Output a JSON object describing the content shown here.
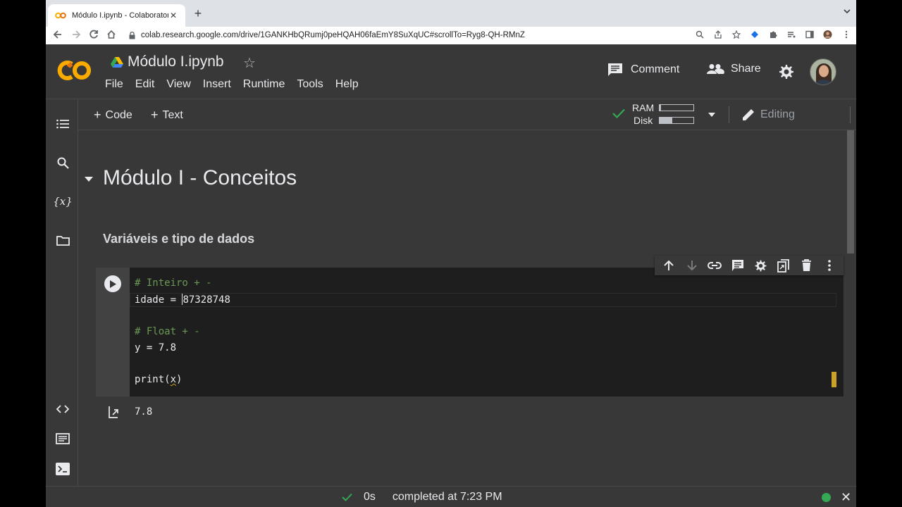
{
  "browser": {
    "tab_title": "Módulo I.ipynb - Colaboratory",
    "tab_close": "✕",
    "new_tab": "+",
    "url": "colab.research.google.com/drive/1GANKHbQRumj0peHQAH06faEmY8SuXqUC#scrollTo=Ryg8-QH-RMnZ"
  },
  "header": {
    "notebook_title": "Módulo I.ipynb",
    "menu": [
      "File",
      "Edit",
      "View",
      "Insert",
      "Runtime",
      "Tools",
      "Help"
    ],
    "comment_label": "Comment",
    "share_label": "Share"
  },
  "toolbar": {
    "add_code_label": "Code",
    "add_text_label": "Text",
    "ram_label": "RAM",
    "disk_label": "Disk",
    "ram_usage": 0.04,
    "disk_usage": 0.38,
    "editing_label": "Editing"
  },
  "notebook": {
    "section_title": "Módulo I - Conceitos",
    "subsection_title": "Variáveis e tipo de dados",
    "code_lines": [
      "# Inteiro + -",
      "idade = ",
      "87328748",
      "# Float + -",
      "y = 7.8",
      "print(",
      "x",
      ")"
    ],
    "output": "7.8"
  },
  "status": {
    "duration": "0s",
    "message": "completed at 7:23 PM"
  },
  "colors": {
    "accent_orange": "#f9ab00",
    "comment_green": "#6a9955",
    "status_green": "#34a853",
    "warning_yellow": "#c9a227"
  }
}
